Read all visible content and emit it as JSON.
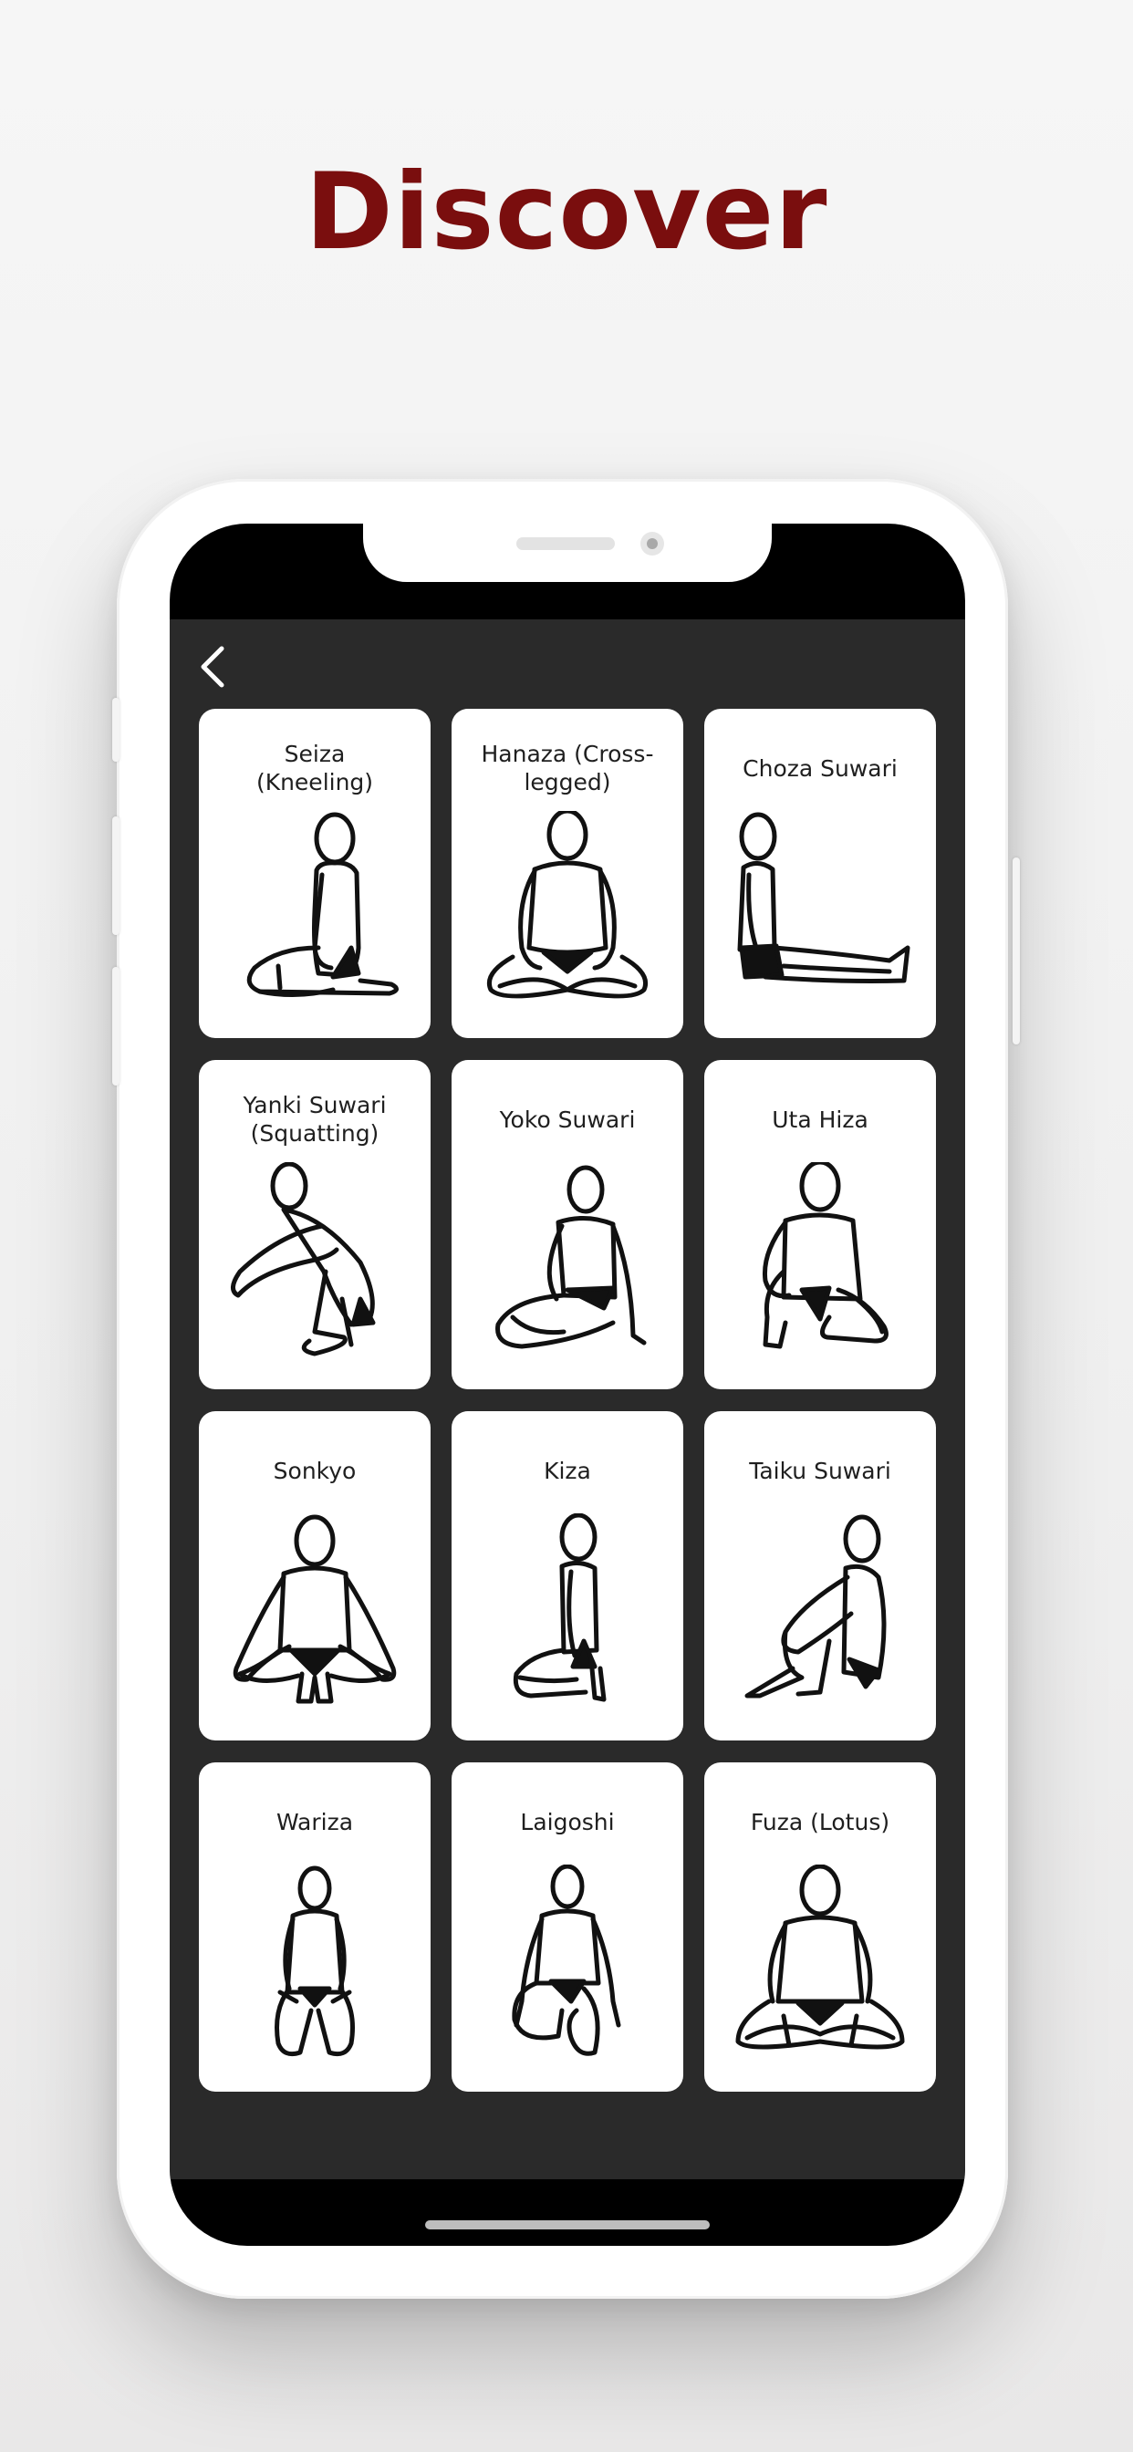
{
  "headline": "Discover",
  "screen": {
    "back_icon": "chevron-left-icon",
    "postures": [
      {
        "label": "Seiza\n(Kneeling)",
        "figure": "kneeling"
      },
      {
        "label": "Hanaza (Cross-\nlegged)",
        "figure": "crosslegged"
      },
      {
        "label": "Choza Suwari",
        "figure": "legs-out"
      },
      {
        "label": "Yanki Suwari\n(Squatting)",
        "figure": "squat-side"
      },
      {
        "label": "Yoko Suwari",
        "figure": "side-sit"
      },
      {
        "label": "Uta Hiza",
        "figure": "one-knee"
      },
      {
        "label": "Sonkyo",
        "figure": "squat-front"
      },
      {
        "label": "Kiza",
        "figure": "kneeling-toes"
      },
      {
        "label": "Taiku Suwari",
        "figure": "knees-hug"
      },
      {
        "label": "Wariza",
        "figure": "w-sit"
      },
      {
        "label": "Laigoshi",
        "figure": "half-kneel"
      },
      {
        "label": "Fuza (Lotus)",
        "figure": "lotus"
      }
    ]
  },
  "colors": {
    "headline": "#7a0e0e",
    "app_background": "#2a2a2a",
    "card_background": "#ffffff"
  }
}
